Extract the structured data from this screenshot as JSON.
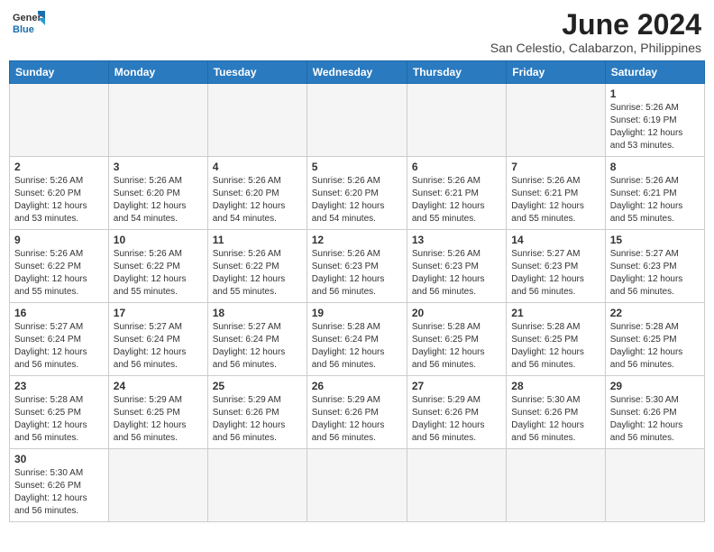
{
  "header": {
    "logo_general": "General",
    "logo_blue": "Blue",
    "month_title": "June 2024",
    "subtitle": "San Celestio, Calabarzon, Philippines"
  },
  "weekdays": [
    "Sunday",
    "Monday",
    "Tuesday",
    "Wednesday",
    "Thursday",
    "Friday",
    "Saturday"
  ],
  "weeks": [
    [
      {
        "day": "",
        "info": ""
      },
      {
        "day": "",
        "info": ""
      },
      {
        "day": "",
        "info": ""
      },
      {
        "day": "",
        "info": ""
      },
      {
        "day": "",
        "info": ""
      },
      {
        "day": "",
        "info": ""
      },
      {
        "day": "1",
        "info": "Sunrise: 5:26 AM\nSunset: 6:19 PM\nDaylight: 12 hours\nand 53 minutes."
      }
    ],
    [
      {
        "day": "2",
        "info": "Sunrise: 5:26 AM\nSunset: 6:20 PM\nDaylight: 12 hours\nand 53 minutes."
      },
      {
        "day": "3",
        "info": "Sunrise: 5:26 AM\nSunset: 6:20 PM\nDaylight: 12 hours\nand 54 minutes."
      },
      {
        "day": "4",
        "info": "Sunrise: 5:26 AM\nSunset: 6:20 PM\nDaylight: 12 hours\nand 54 minutes."
      },
      {
        "day": "5",
        "info": "Sunrise: 5:26 AM\nSunset: 6:20 PM\nDaylight: 12 hours\nand 54 minutes."
      },
      {
        "day": "6",
        "info": "Sunrise: 5:26 AM\nSunset: 6:21 PM\nDaylight: 12 hours\nand 55 minutes."
      },
      {
        "day": "7",
        "info": "Sunrise: 5:26 AM\nSunset: 6:21 PM\nDaylight: 12 hours\nand 55 minutes."
      },
      {
        "day": "8",
        "info": "Sunrise: 5:26 AM\nSunset: 6:21 PM\nDaylight: 12 hours\nand 55 minutes."
      }
    ],
    [
      {
        "day": "9",
        "info": "Sunrise: 5:26 AM\nSunset: 6:22 PM\nDaylight: 12 hours\nand 55 minutes."
      },
      {
        "day": "10",
        "info": "Sunrise: 5:26 AM\nSunset: 6:22 PM\nDaylight: 12 hours\nand 55 minutes."
      },
      {
        "day": "11",
        "info": "Sunrise: 5:26 AM\nSunset: 6:22 PM\nDaylight: 12 hours\nand 55 minutes."
      },
      {
        "day": "12",
        "info": "Sunrise: 5:26 AM\nSunset: 6:23 PM\nDaylight: 12 hours\nand 56 minutes."
      },
      {
        "day": "13",
        "info": "Sunrise: 5:26 AM\nSunset: 6:23 PM\nDaylight: 12 hours\nand 56 minutes."
      },
      {
        "day": "14",
        "info": "Sunrise: 5:27 AM\nSunset: 6:23 PM\nDaylight: 12 hours\nand 56 minutes."
      },
      {
        "day": "15",
        "info": "Sunrise: 5:27 AM\nSunset: 6:23 PM\nDaylight: 12 hours\nand 56 minutes."
      }
    ],
    [
      {
        "day": "16",
        "info": "Sunrise: 5:27 AM\nSunset: 6:24 PM\nDaylight: 12 hours\nand 56 minutes."
      },
      {
        "day": "17",
        "info": "Sunrise: 5:27 AM\nSunset: 6:24 PM\nDaylight: 12 hours\nand 56 minutes."
      },
      {
        "day": "18",
        "info": "Sunrise: 5:27 AM\nSunset: 6:24 PM\nDaylight: 12 hours\nand 56 minutes."
      },
      {
        "day": "19",
        "info": "Sunrise: 5:28 AM\nSunset: 6:24 PM\nDaylight: 12 hours\nand 56 minutes."
      },
      {
        "day": "20",
        "info": "Sunrise: 5:28 AM\nSunset: 6:25 PM\nDaylight: 12 hours\nand 56 minutes."
      },
      {
        "day": "21",
        "info": "Sunrise: 5:28 AM\nSunset: 6:25 PM\nDaylight: 12 hours\nand 56 minutes."
      },
      {
        "day": "22",
        "info": "Sunrise: 5:28 AM\nSunset: 6:25 PM\nDaylight: 12 hours\nand 56 minutes."
      }
    ],
    [
      {
        "day": "23",
        "info": "Sunrise: 5:28 AM\nSunset: 6:25 PM\nDaylight: 12 hours\nand 56 minutes."
      },
      {
        "day": "24",
        "info": "Sunrise: 5:29 AM\nSunset: 6:25 PM\nDaylight: 12 hours\nand 56 minutes."
      },
      {
        "day": "25",
        "info": "Sunrise: 5:29 AM\nSunset: 6:26 PM\nDaylight: 12 hours\nand 56 minutes."
      },
      {
        "day": "26",
        "info": "Sunrise: 5:29 AM\nSunset: 6:26 PM\nDaylight: 12 hours\nand 56 minutes."
      },
      {
        "day": "27",
        "info": "Sunrise: 5:29 AM\nSunset: 6:26 PM\nDaylight: 12 hours\nand 56 minutes."
      },
      {
        "day": "28",
        "info": "Sunrise: 5:30 AM\nSunset: 6:26 PM\nDaylight: 12 hours\nand 56 minutes."
      },
      {
        "day": "29",
        "info": "Sunrise: 5:30 AM\nSunset: 6:26 PM\nDaylight: 12 hours\nand 56 minutes."
      }
    ],
    [
      {
        "day": "30",
        "info": "Sunrise: 5:30 AM\nSunset: 6:26 PM\nDaylight: 12 hours\nand 56 minutes."
      },
      {
        "day": "",
        "info": ""
      },
      {
        "day": "",
        "info": ""
      },
      {
        "day": "",
        "info": ""
      },
      {
        "day": "",
        "info": ""
      },
      {
        "day": "",
        "info": ""
      },
      {
        "day": "",
        "info": ""
      }
    ]
  ]
}
